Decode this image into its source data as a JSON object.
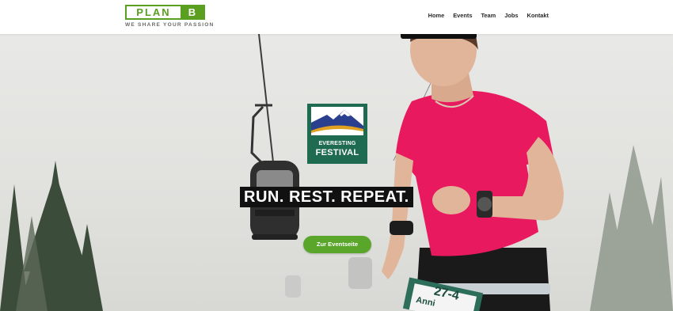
{
  "logo": {
    "main": "PLAN",
    "letter": "B",
    "tagline": "WE SHARE YOUR PASSION"
  },
  "nav": {
    "items": [
      "Home",
      "Events",
      "Team",
      "Jobs",
      "Kontakt"
    ]
  },
  "hero": {
    "badge": {
      "line1": "EVERESTING",
      "line2": "FESTIVAL"
    },
    "headline": "RUN. REST. REPEAT.",
    "cta_label": "Zur Eventseite",
    "bib": {
      "number": "27-4",
      "name": "Anni"
    }
  },
  "colors": {
    "brand_green": "#5a9f1f",
    "cta_green": "#5aa62a",
    "badge_green": "#1f6b52",
    "shirt": "#e8195f"
  }
}
